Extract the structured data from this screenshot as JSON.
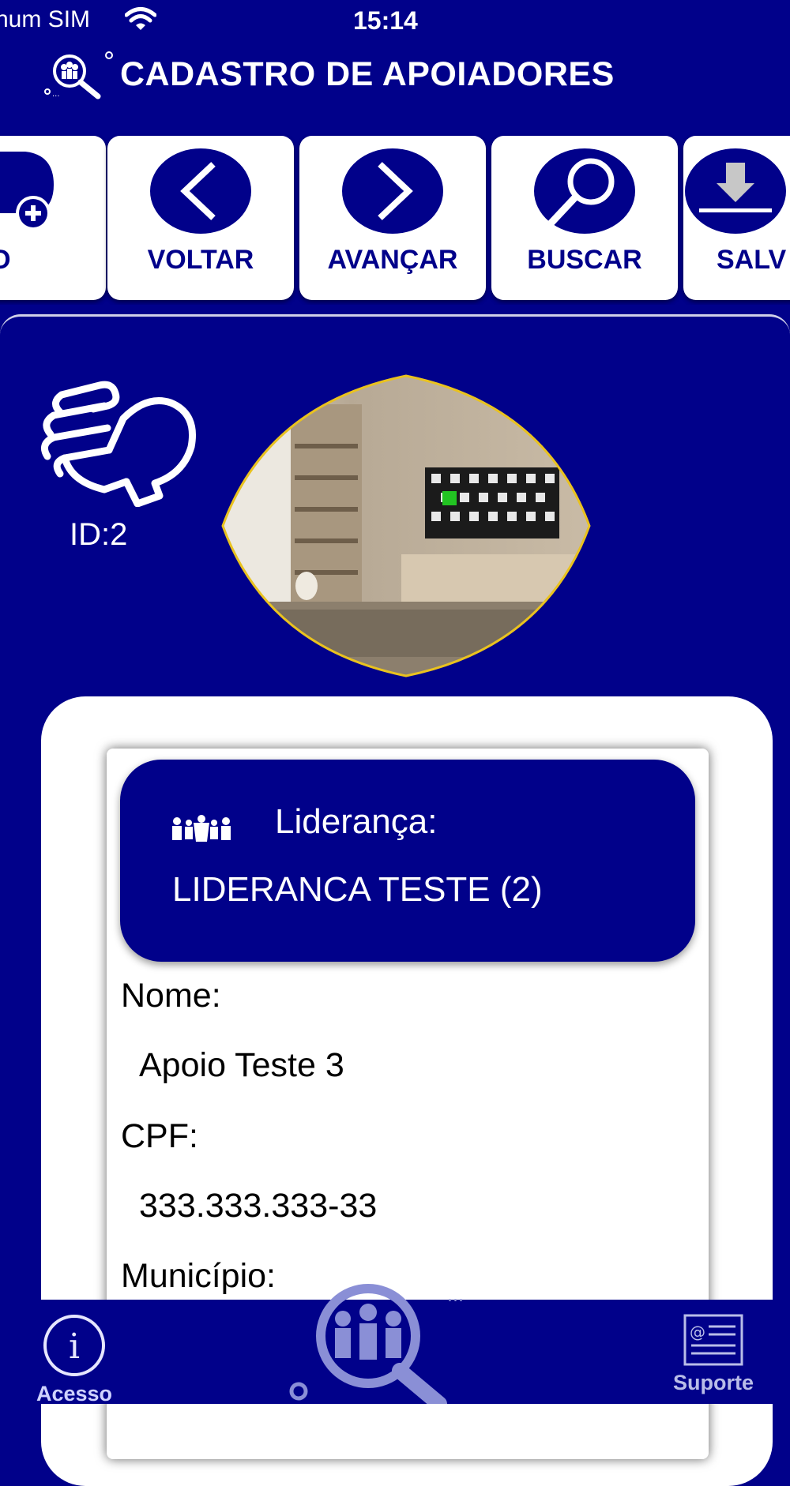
{
  "status_bar": {
    "carrier": "num SIM",
    "time": "15:14"
  },
  "header": {
    "title": "CADASTRO DE APOIADORES"
  },
  "toolbar": {
    "buttons": [
      {
        "label": "OVO",
        "icon": "new-document-icon"
      },
      {
        "label": "VOLTAR",
        "icon": "chevron-left-icon"
      },
      {
        "label": "AVANÇAR",
        "icon": "chevron-right-icon"
      },
      {
        "label": "BUSCAR",
        "icon": "search-icon"
      },
      {
        "label": "SALV",
        "icon": "download-icon"
      }
    ]
  },
  "record": {
    "id_text": "ID:2"
  },
  "lideranca": {
    "label": "Liderança:",
    "value": "LIDERANCA TESTE (2)"
  },
  "form": {
    "nome_label": "Nome:",
    "nome_value": "Apoio Teste 3",
    "cpf_label": "CPF:",
    "cpf_value": "333.333.333-33",
    "municipio_label": "Município:"
  },
  "tabbar": {
    "left_label": "Acesso",
    "right_label": "Suporte"
  },
  "colors": {
    "primary": "#01018a",
    "accent_border": "#e9c21f",
    "white": "#ffffff"
  }
}
